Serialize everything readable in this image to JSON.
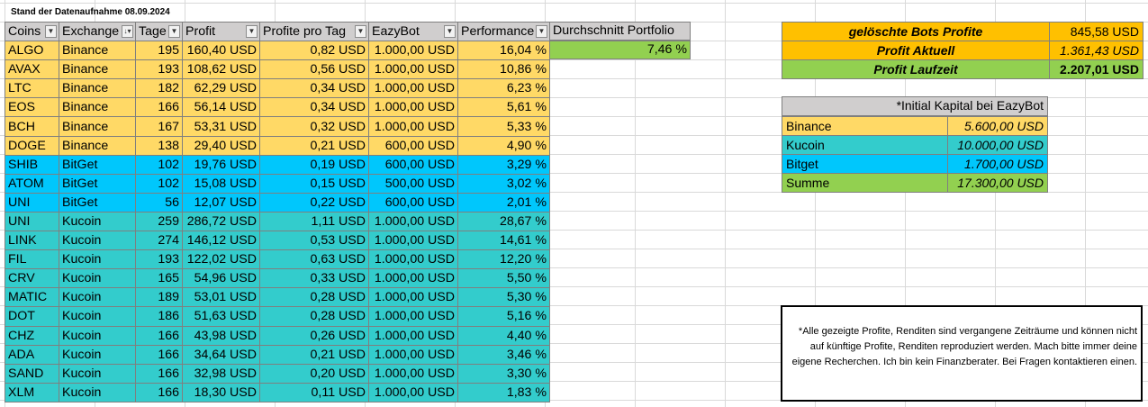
{
  "stand": "Stand der Datenaufnahme 08.09.2024",
  "headers": {
    "coins": "Coins",
    "exchange": "Exchange",
    "tage": "Tage",
    "profit": "Profit",
    "profit_pro_tag": "Profite pro Tag",
    "eazybot": "EazyBot",
    "performance": "Performance",
    "durchschnitt": "Durchschnitt Portfolio"
  },
  "durchschnitt_value": "7,46 %",
  "rows": [
    {
      "coin": "ALGO",
      "exchange": "Binance",
      "tage": "195",
      "profit": "160,40 USD",
      "pro_tag": "0,82 USD",
      "eazybot": "1.000,00 USD",
      "performance": "16,04 %"
    },
    {
      "coin": "AVAX",
      "exchange": "Binance",
      "tage": "193",
      "profit": "108,62 USD",
      "pro_tag": "0,56 USD",
      "eazybot": "1.000,00 USD",
      "performance": "10,86 %"
    },
    {
      "coin": "LTC",
      "exchange": "Binance",
      "tage": "182",
      "profit": "62,29 USD",
      "pro_tag": "0,34 USD",
      "eazybot": "1.000,00 USD",
      "performance": "6,23 %"
    },
    {
      "coin": "EOS",
      "exchange": "Binance",
      "tage": "166",
      "profit": "56,14 USD",
      "pro_tag": "0,34 USD",
      "eazybot": "1.000,00 USD",
      "performance": "5,61 %"
    },
    {
      "coin": "BCH",
      "exchange": "Binance",
      "tage": "167",
      "profit": "53,31 USD",
      "pro_tag": "0,32 USD",
      "eazybot": "1.000,00 USD",
      "performance": "5,33 %"
    },
    {
      "coin": "DOGE",
      "exchange": "Binance",
      "tage": "138",
      "profit": "29,40 USD",
      "pro_tag": "0,21 USD",
      "eazybot": "600,00 USD",
      "performance": "4,90 %"
    },
    {
      "coin": "SHIB",
      "exchange": "BitGet",
      "tage": "102",
      "profit": "19,76 USD",
      "pro_tag": "0,19 USD",
      "eazybot": "600,00 USD",
      "performance": "3,29 %"
    },
    {
      "coin": "ATOM",
      "exchange": "BitGet",
      "tage": "102",
      "profit": "15,08 USD",
      "pro_tag": "0,15 USD",
      "eazybot": "500,00 USD",
      "performance": "3,02 %"
    },
    {
      "coin": "UNI",
      "exchange": "BitGet",
      "tage": "56",
      "profit": "12,07 USD",
      "pro_tag": "0,22 USD",
      "eazybot": "600,00 USD",
      "performance": "2,01 %"
    },
    {
      "coin": "UNI",
      "exchange": "Kucoin",
      "tage": "259",
      "profit": "286,72 USD",
      "pro_tag": "1,11 USD",
      "eazybot": "1.000,00 USD",
      "performance": "28,67 %"
    },
    {
      "coin": "LINK",
      "exchange": "Kucoin",
      "tage": "274",
      "profit": "146,12 USD",
      "pro_tag": "0,53 USD",
      "eazybot": "1.000,00 USD",
      "performance": "14,61 %"
    },
    {
      "coin": "FIL",
      "exchange": "Kucoin",
      "tage": "193",
      "profit": "122,02 USD",
      "pro_tag": "0,63 USD",
      "eazybot": "1.000,00 USD",
      "performance": "12,20 %"
    },
    {
      "coin": "CRV",
      "exchange": "Kucoin",
      "tage": "165",
      "profit": "54,96 USD",
      "pro_tag": "0,33 USD",
      "eazybot": "1.000,00 USD",
      "performance": "5,50 %"
    },
    {
      "coin": "MATIC",
      "exchange": "Kucoin",
      "tage": "189",
      "profit": "53,01 USD",
      "pro_tag": "0,28 USD",
      "eazybot": "1.000,00 USD",
      "performance": "5,30 %"
    },
    {
      "coin": "DOT",
      "exchange": "Kucoin",
      "tage": "186",
      "profit": "51,63 USD",
      "pro_tag": "0,28 USD",
      "eazybot": "1.000,00 USD",
      "performance": "5,16 %"
    },
    {
      "coin": "CHZ",
      "exchange": "Kucoin",
      "tage": "166",
      "profit": "43,98 USD",
      "pro_tag": "0,26 USD",
      "eazybot": "1.000,00 USD",
      "performance": "4,40 %"
    },
    {
      "coin": "ADA",
      "exchange": "Kucoin",
      "tage": "166",
      "profit": "34,64 USD",
      "pro_tag": "0,21 USD",
      "eazybot": "1.000,00 USD",
      "performance": "3,46 %"
    },
    {
      "coin": "SAND",
      "exchange": "Kucoin",
      "tage": "166",
      "profit": "32,98 USD",
      "pro_tag": "0,20 USD",
      "eazybot": "1.000,00 USD",
      "performance": "3,30 %"
    },
    {
      "coin": "XLM",
      "exchange": "Kucoin",
      "tage": "166",
      "profit": "18,30 USD",
      "pro_tag": "0,11 USD",
      "eazybot": "1.000,00 USD",
      "performance": "1,83 %"
    }
  ],
  "summary": {
    "geloeschte_label": "gelöschte Bots Profite",
    "geloeschte_value": "845,58 USD",
    "aktuell_label": "Profit Aktuell",
    "aktuell_value": "1.361,43 USD",
    "laufzeit_label": "Profit Laufzeit",
    "laufzeit_value": "2.207,01 USD"
  },
  "capital": {
    "title": "*Initial Kapital bei EazyBot",
    "rows": [
      {
        "name": "Binance",
        "amount": "5.600,00 USD"
      },
      {
        "name": "Kucoin",
        "amount": "10.000,00 USD"
      },
      {
        "name": "Bitget",
        "amount": "1.700,00 USD"
      },
      {
        "name": "Summe",
        "amount": "17.300,00 USD"
      }
    ]
  },
  "disclaimer": "*Alle gezeigte Profite, Renditen sind vergangene Zeiträume und können nicht auf künftige Profite, Renditen reproduziert werden. Mach bitte immer deine eigene Recherchen. Ich bin kein Finanzberater. Bei Fragen kontaktieren einen.",
  "icons": {
    "filter": "dropdown-arrow",
    "sort": "sort-arrow"
  },
  "colors": {
    "binance": "#ffd966",
    "bitget": "#00c7fc",
    "kucoin": "#33cccc",
    "header": "#d0cece",
    "green": "#92d050",
    "orange": "#ffc000"
  }
}
